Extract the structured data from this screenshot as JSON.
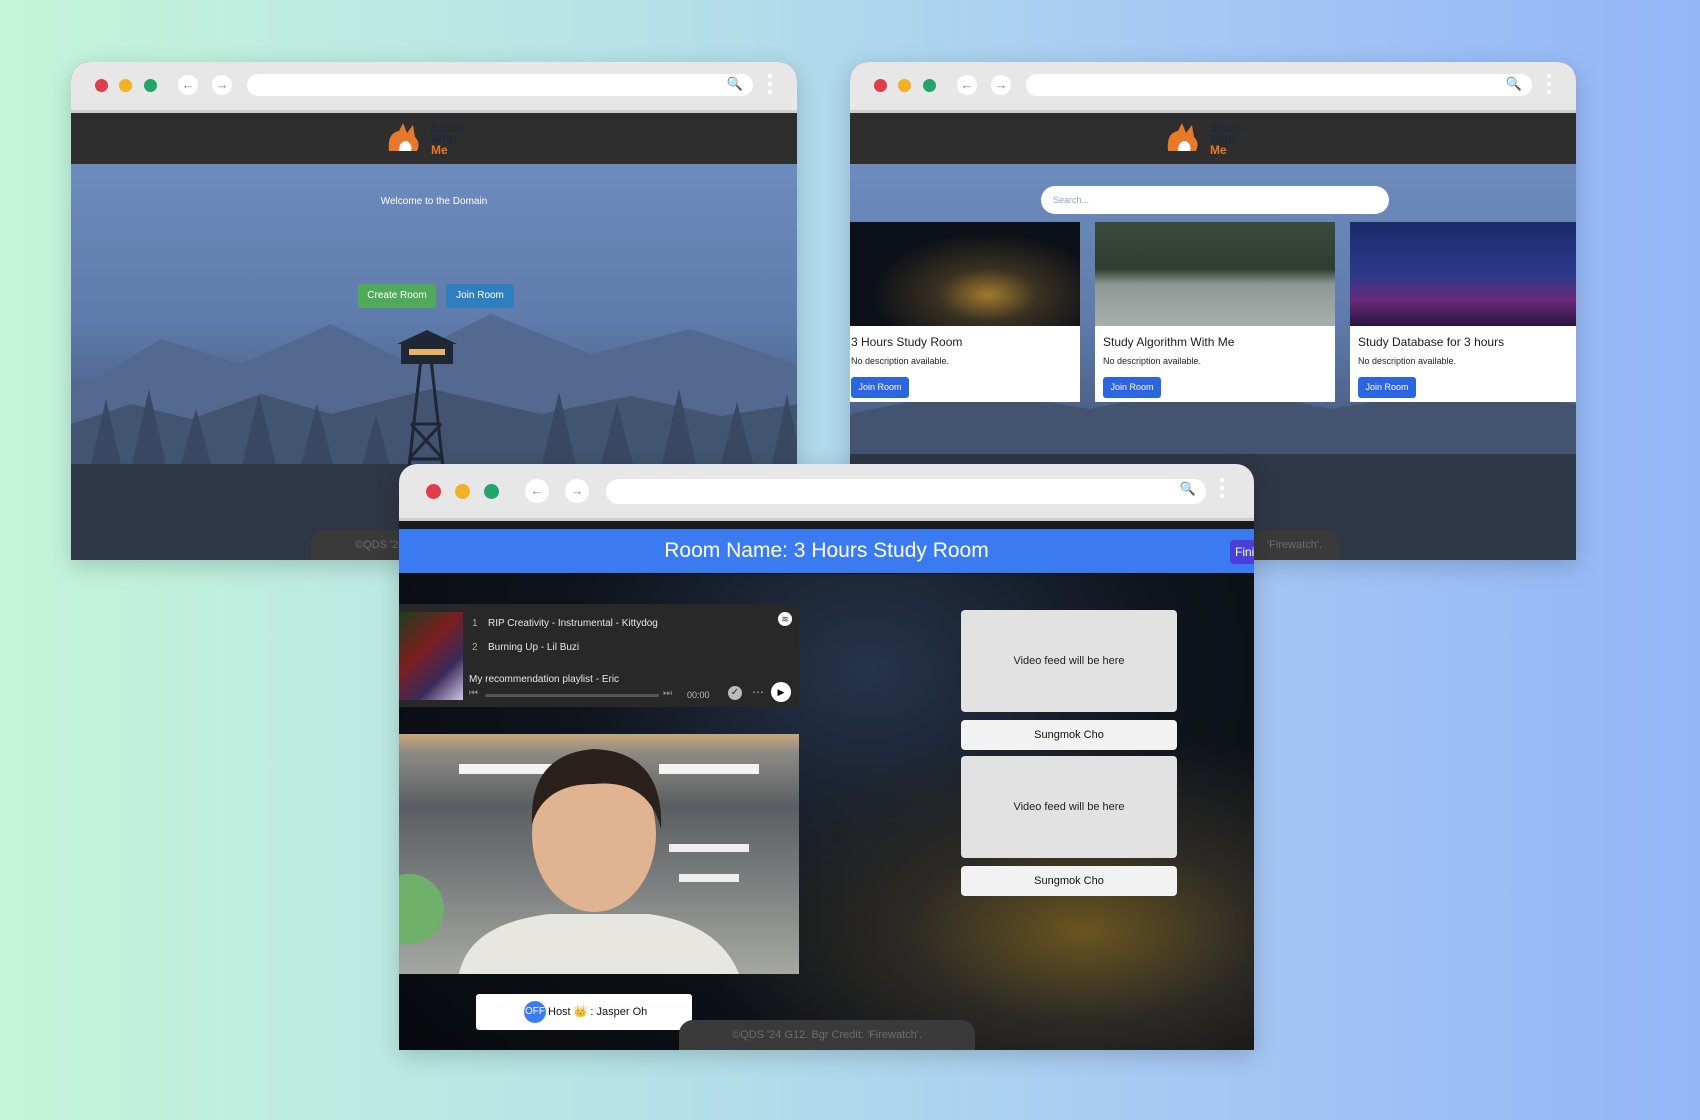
{
  "common": {
    "logo": {
      "line1": "Study",
      "line2": "With",
      "line3": "Me"
    },
    "colors": {
      "close": "#e23b4a",
      "minimize": "#f2b125",
      "maximize": "#24a36a",
      "accent_blue": "#3b7bf2"
    },
    "icons": {
      "back": "←",
      "forward": "→",
      "search": "🔍"
    }
  },
  "window1": {
    "welcome": "Welcome to the Domain",
    "create_room": "Create Room",
    "join_room": "Join Room",
    "footer": "©QDS '24"
  },
  "window2": {
    "search_placeholder": "Search...",
    "footer_tail": "'Firewatch'.",
    "rooms": [
      {
        "title": "3 Hours Study Room",
        "description": "No description available.",
        "button": "Join Room"
      },
      {
        "title": "Study Algorithm With Me",
        "description": "No description available.",
        "button": "Join Room"
      },
      {
        "title": "Study Database for 3 hours",
        "description": "No description available.",
        "button": "Join Room"
      }
    ]
  },
  "window3": {
    "room_name": "Room Name: 3 Hours Study Room",
    "finish_button": "Fini",
    "playlist": {
      "tracks": [
        {
          "number": "1",
          "text": "RIP Creativity - Instrumental - Kittydog"
        },
        {
          "number": "2",
          "text": "Burning Up - Lil Buzi"
        }
      ],
      "title": "My recommendation playlist - Eric",
      "time": "00:00"
    },
    "video_feeds": [
      {
        "placeholder": "Video feed will be here",
        "name": "Sungmok Cho"
      },
      {
        "placeholder": "Video feed will be here",
        "name": "Sungmok Cho"
      }
    ],
    "host": {
      "badge": "OFF",
      "label": "Host 👑 : Jasper Oh"
    },
    "footer": "©QDS '24 G12. Bgr Credit: 'Firewatch'."
  }
}
